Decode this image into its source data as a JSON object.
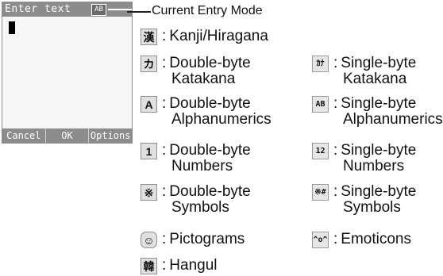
{
  "screen": {
    "title": "Enter text",
    "mode_badge": "AB",
    "soft_keys": [
      "Cancel",
      "OK",
      "Options"
    ]
  },
  "callout": {
    "text": "Current Entry Mode"
  },
  "legend": {
    "kanji": {
      "icon": "漢",
      "label": "Kanji/Hiragana"
    },
    "dbl_katakana": {
      "icon": "カ",
      "line1": "Double-byte",
      "line2": "Katakana"
    },
    "sgl_katakana": {
      "icon": "ｶﾅ",
      "line1": "Single-byte",
      "line2": "Katakana"
    },
    "dbl_alpha": {
      "icon": "A",
      "line1": "Double-byte",
      "line2": "Alphanumerics"
    },
    "sgl_alpha": {
      "icon": "AB",
      "line1": "Single-byte",
      "line2": "Alphanumerics"
    },
    "dbl_num": {
      "icon": "1",
      "line1": "Double-byte",
      "line2": "Numbers"
    },
    "sgl_num": {
      "icon": "12",
      "line1": "Single-byte",
      "line2": "Numbers"
    },
    "dbl_sym": {
      "icon": "※",
      "line1": "Double-byte",
      "line2": "Symbols"
    },
    "sgl_sym": {
      "icon": "※#",
      "line1": "Single-byte",
      "line2": "Symbols"
    },
    "pictograms": {
      "icon": "☺",
      "label": "Pictograms"
    },
    "emoticons": {
      "icon": "^o^",
      "label": "Emoticons"
    },
    "hangul": {
      "icon": "韓",
      "label": "Hangul"
    }
  }
}
